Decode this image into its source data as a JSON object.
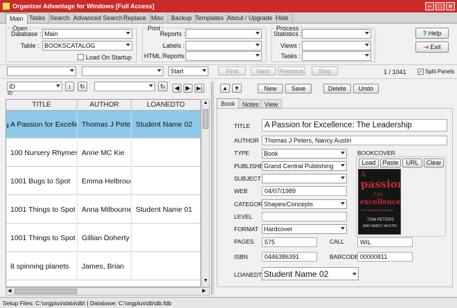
{
  "window": {
    "title": "Organizer Advantage for Windows [Full Access]"
  },
  "tabs": [
    "Main",
    "Tasks",
    "Search",
    "Advanced Search",
    "Replace",
    "Misc",
    "Backup",
    "Templates",
    "About / Upgrade",
    "Hide"
  ],
  "open": {
    "legend": "Open :",
    "database_label": "Database :",
    "database_value": "Main",
    "table_label": "Table :",
    "table_value": "BOOKSCATALOG",
    "load_startup": "Load On Startup"
  },
  "print": {
    "legend": "Print :",
    "reports": "Reports :",
    "labels": "Labels :",
    "html_reports": "HTML Reports :"
  },
  "process": {
    "legend": "Process :",
    "statistics": "Statistics :",
    "views": "Views :",
    "tasks": "Tasks :"
  },
  "buttons": {
    "help": "Help",
    "exit": "Exit"
  },
  "searchbar": {
    "start": "Start",
    "find": "Find",
    "next": "Next",
    "previous": "Previous",
    "stop": "Stop",
    "record_count": "1 / 1041",
    "split_panels": "Split Panels"
  },
  "sortbar": {
    "field": "ID",
    "sub": "ID"
  },
  "record_buttons": {
    "new": "New",
    "save": "Save",
    "delete": "Delete",
    "undo": "Undo"
  },
  "form_tabs": [
    "Book",
    "Notes",
    "View"
  ],
  "grid": {
    "columns": [
      "TITLE",
      "AUTHOR",
      "LOANEDTO"
    ],
    "rows": [
      {
        "title": "A Passion for Excellence: The Leadership",
        "author": "Thomas J Peters, Nancy Austin",
        "loanedto": "Student Name 02"
      },
      {
        "title": "100 Nursery Rhymes",
        "author": "Anne MC Kie",
        "loanedto": ""
      },
      {
        "title": "1001 Bugs to Spot",
        "author": "Emma Helbrough",
        "loanedto": ""
      },
      {
        "title": "1001 Things to Spot",
        "author": "Anna Milbourne",
        "loanedto": "Student Name 01"
      },
      {
        "title": "1001 Things to Spot",
        "author": "Gillian Doherty",
        "loanedto": ""
      },
      {
        "title": "8 spinning planets",
        "author": "James, Brian",
        "loanedto": ""
      }
    ]
  },
  "form": {
    "title_label": "TITLE",
    "title": "A Passion for Excellence: The Leadership",
    "author_label": "AUTHOR",
    "author": "Thomas J Peters, Nancy Austin",
    "type_label": "TYPE",
    "type": "Book",
    "published_label": "PUBLISHED",
    "published": "Grand Central Publishing",
    "subject_label": "SUBJECT",
    "subject": "",
    "web_label": "WEB",
    "web": "04/07/1989",
    "category_label": "CATEGORY",
    "category": "Shapes/Concepts",
    "level_label": "LEVEL",
    "level": "",
    "format_label": "FORMAT",
    "format": "Hardcover",
    "pages_label": "PAGES",
    "pages": "575",
    "call_label": "CALL",
    "call": "WIL",
    "isbn_label": "ISBN",
    "isbn": "0446386391",
    "barcode_label": "BARCODE",
    "barcode": "00000811",
    "loanedto_label": "LOANEDTO",
    "loanedto": "Student Name 02",
    "bookcover_label": "BOOKCOVER",
    "load": "Load",
    "paste": "Paste",
    "url": "URL",
    "clear": "Clear"
  },
  "cover": {
    "line1": "A",
    "line2": "passion",
    "line3": "FOR",
    "line4": "excellence",
    "line5": "The Leadership Difference",
    "line6": "TOM PETERS",
    "line7": "AND NANCY AUSTIN"
  },
  "status": {
    "text": "Setup Files: C:\\orgplus\\data\\db\\ | Database: C:\\orgplus\\db\\db.fdb"
  }
}
